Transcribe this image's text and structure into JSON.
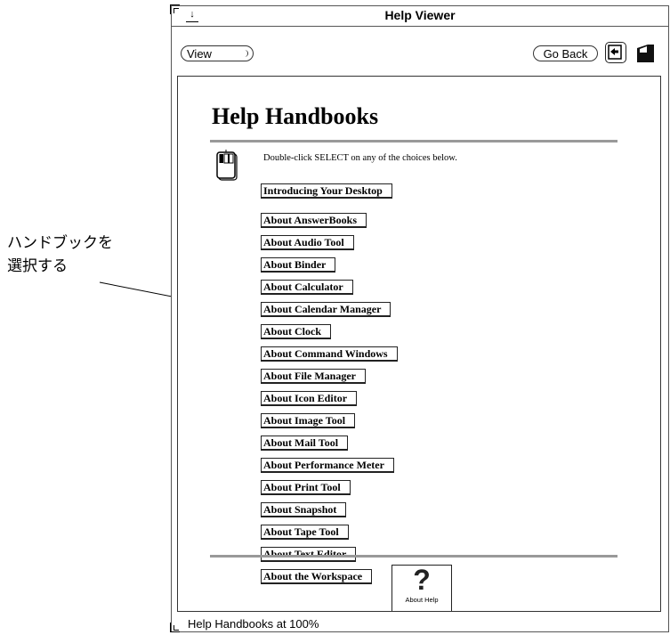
{
  "callout": {
    "line1": "ハンドブックを",
    "line2": "選択する"
  },
  "window": {
    "title": "Help Viewer",
    "menu_mark": "↓"
  },
  "toolbar": {
    "view_label": "View",
    "go_back_label": "Go Back",
    "icons": [
      "navigator-icon",
      "page-icon"
    ]
  },
  "content": {
    "heading": "Help Handbooks",
    "instruction": "Double-click SELECT on any of the choices below.",
    "links": [
      "Introducing Your Desktop",
      "About AnswerBooks",
      "About Audio Tool",
      "About Binder",
      "About Calculator",
      "About Calendar Manager",
      "About Clock",
      "About Command Windows",
      "About File Manager",
      "About Icon Editor",
      "About Image Tool",
      "About Mail Tool",
      "About Performance Meter",
      "About Print Tool",
      "About Snapshot",
      "About Tape Tool",
      "About Text Editor",
      "About the Workspace"
    ],
    "about_help": {
      "symbol": "?",
      "label": "About Help"
    }
  },
  "status": {
    "text": "Help Handbooks at 100%"
  },
  "colors": {
    "rule": "#999999",
    "border": "#333333"
  }
}
